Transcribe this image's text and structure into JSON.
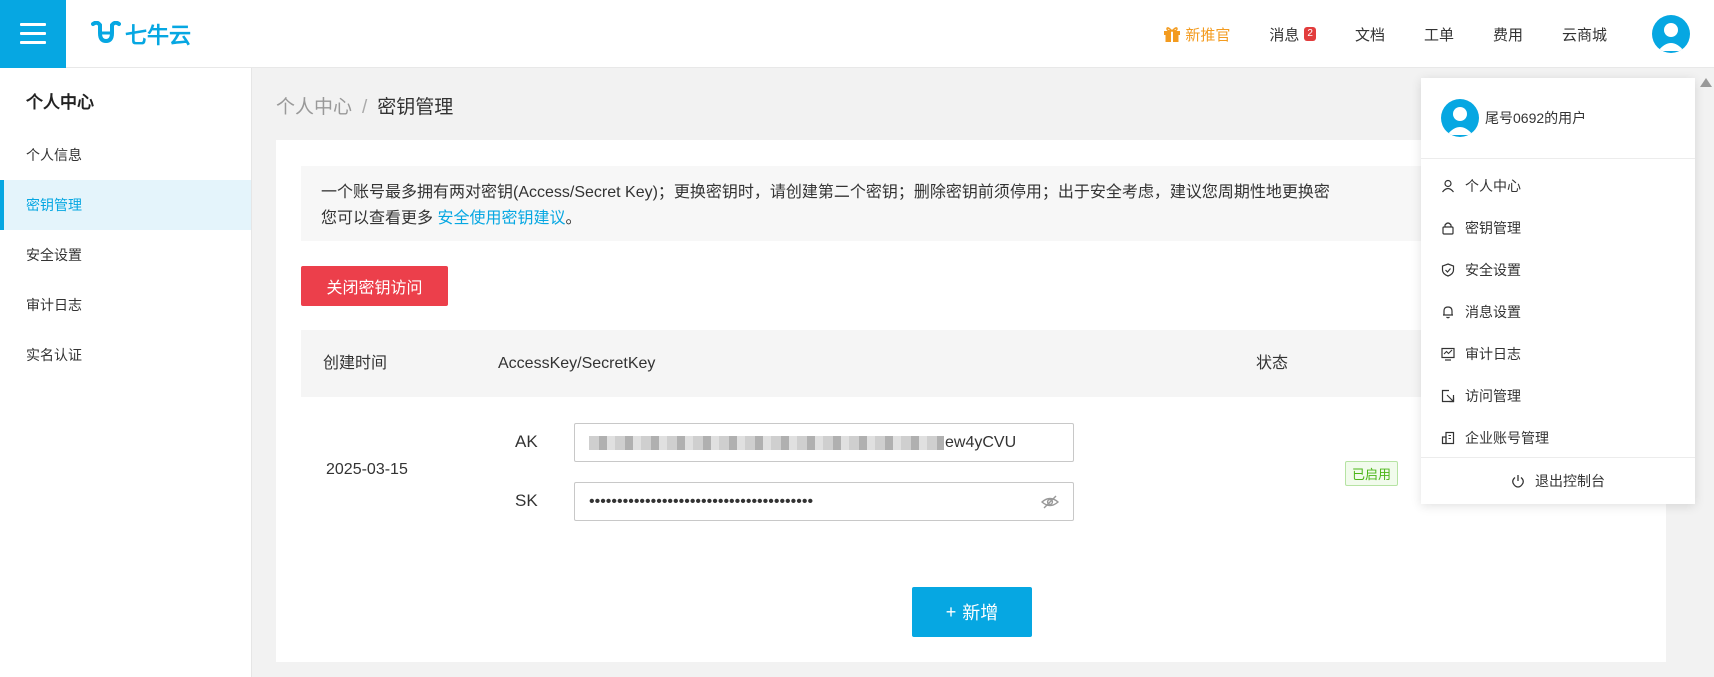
{
  "header": {
    "logo_text": "七牛云",
    "nav": {
      "promo": "新推官",
      "messages": "消息",
      "messages_badge": "2",
      "docs": "文档",
      "tickets": "工单",
      "billing": "费用",
      "market": "云商城"
    },
    "colors": {
      "brand": "#06a7e2",
      "promo": "#f39b1f",
      "badge": "#e23c3c"
    }
  },
  "sidebar": {
    "title": "个人中心",
    "items": [
      {
        "label": "个人信息"
      },
      {
        "label": "密钥管理"
      },
      {
        "label": "安全设置"
      },
      {
        "label": "审计日志"
      },
      {
        "label": "实名认证"
      }
    ]
  },
  "breadcrumb": {
    "root": "个人中心",
    "sep": "/",
    "current": "密钥管理"
  },
  "notice": {
    "line1": "一个账号最多拥有两对密钥(Access/Secret Key)；更换密钥时，请创建第二个密钥；删除密钥前须停用；出于安全考虑，建议您周期性地更换密",
    "line2_prefix": "您可以查看更多",
    "link": "安全使用密钥建议",
    "line2_suffix": "。"
  },
  "buttons": {
    "close_access": "关闭密钥访问",
    "add": "新增",
    "add_icon": "+"
  },
  "table": {
    "headers": {
      "created": "创建时间",
      "keys": "AccessKey/SecretKey",
      "status": "状态"
    },
    "rows": [
      {
        "created": "2025-03-15",
        "ak_label": "AK",
        "ak_visible_suffix": "ew4yCVU",
        "sk_label": "SK",
        "sk_masked": "••••••••••••••••••••••••••••••••••••••••",
        "status": "已启用"
      }
    ]
  },
  "dropdown": {
    "username": "尾号0692的用户",
    "items": [
      {
        "label": "个人中心",
        "icon": "user-icon"
      },
      {
        "label": "密钥管理",
        "icon": "lock-icon"
      },
      {
        "label": "安全设置",
        "icon": "shield-icon"
      },
      {
        "label": "消息设置",
        "icon": "bell-icon"
      },
      {
        "label": "审计日志",
        "icon": "monitor-icon"
      },
      {
        "label": "访问管理",
        "icon": "access-icon"
      },
      {
        "label": "企业账号管理",
        "icon": "building-icon"
      }
    ],
    "logout": "退出控制台"
  }
}
